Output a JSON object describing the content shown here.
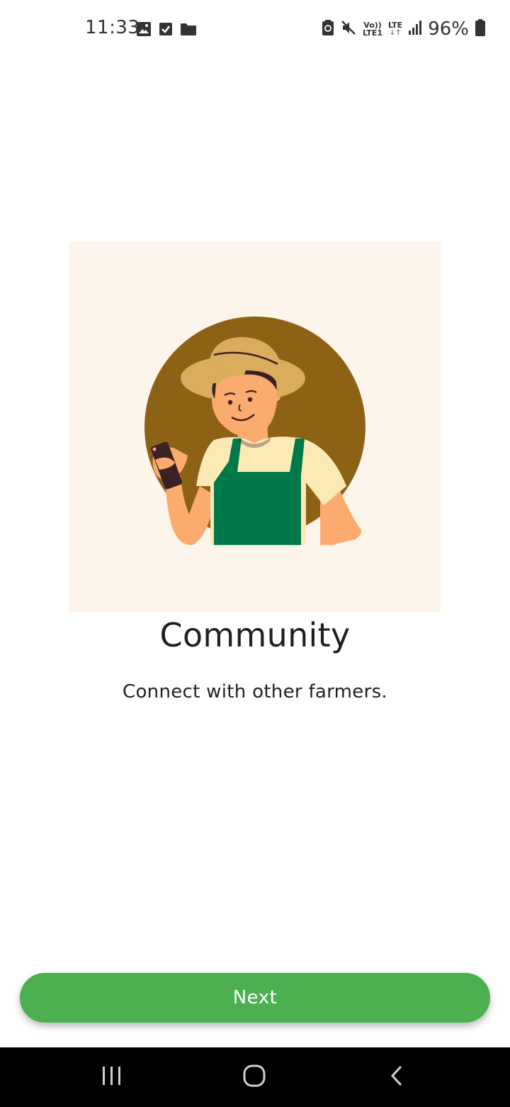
{
  "status_bar": {
    "time": "11:33",
    "left_icons": [
      "gallery-icon",
      "checkbox-icon",
      "folder-icon"
    ],
    "right_icons": [
      "battery-saver-icon",
      "mute-icon",
      "volte-icon",
      "lte-icon",
      "signal-icon",
      "battery-icon"
    ],
    "volte_top": "Vo))",
    "volte_bottom": "LTE1",
    "lte_label": "LTE",
    "battery_text": "96%"
  },
  "onboarding": {
    "title": "Community",
    "subtitle": "Connect with other farmers."
  },
  "next_button": {
    "label": "Next",
    "color": "#4caf50"
  },
  "navigation_bar": {
    "items": [
      "recents-icon",
      "home-icon",
      "back-icon"
    ]
  },
  "colors": {
    "illustration_bg": "#fdf5ec",
    "circle": "#8e6215",
    "hat": "#d9ad5c",
    "apron": "#00794a",
    "shirt": "#fbeab5",
    "skin": "#fcab6f"
  }
}
